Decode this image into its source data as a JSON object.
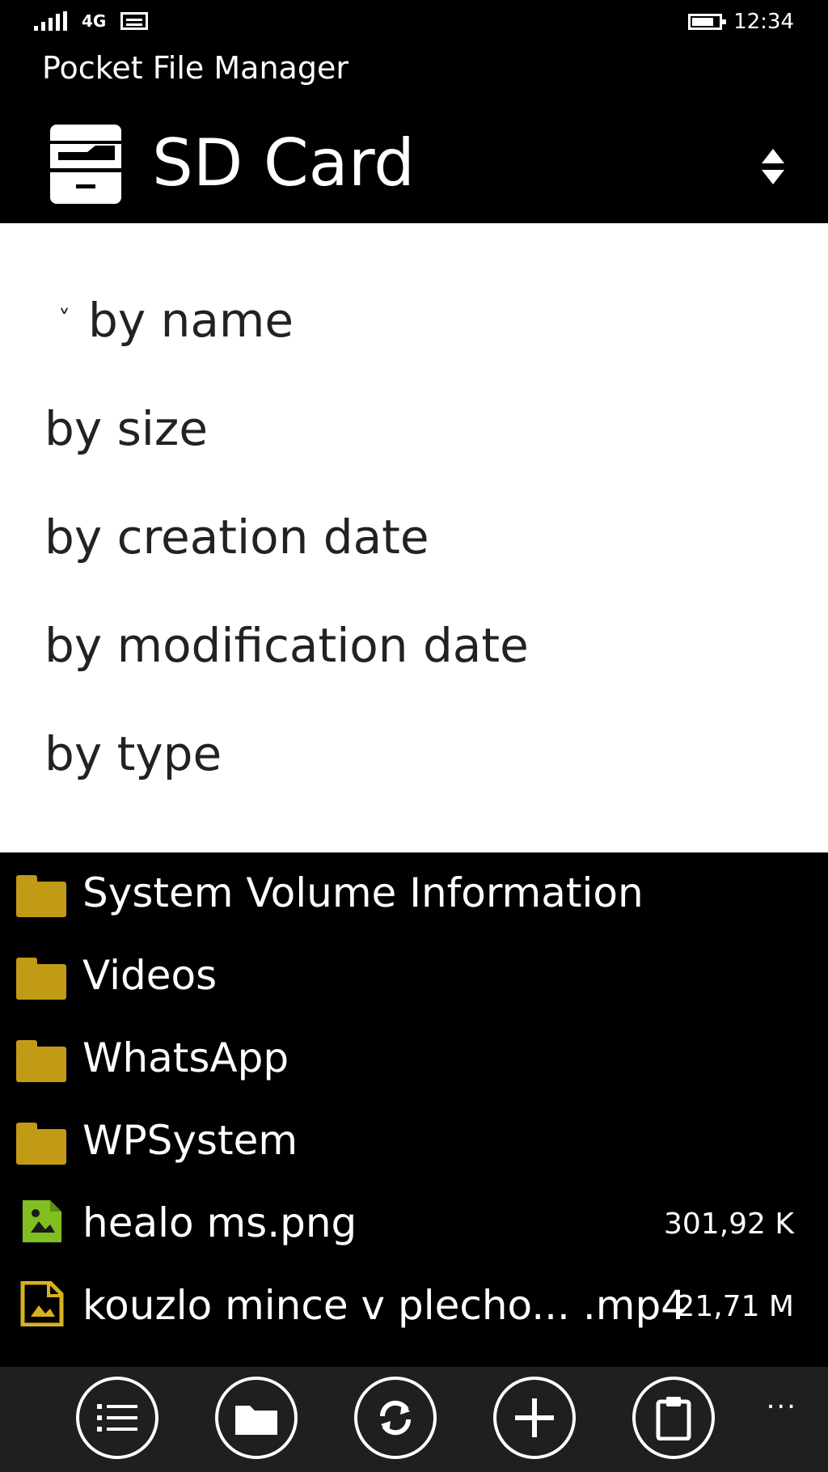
{
  "status": {
    "network": "4G",
    "time": "12:34"
  },
  "app": {
    "title": "Pocket File Manager"
  },
  "header": {
    "location": "SD Card"
  },
  "sort": {
    "selected_marker": "˅",
    "options": [
      "by name",
      "by size",
      "by creation date",
      "by modification date",
      "by type"
    ]
  },
  "files": [
    {
      "name": "System Volume Information",
      "size": "",
      "type": "folder"
    },
    {
      "name": "Videos",
      "size": "",
      "type": "folder"
    },
    {
      "name": "WhatsApp",
      "size": "",
      "type": "folder"
    },
    {
      "name": "WPSystem",
      "size": "",
      "type": "folder"
    },
    {
      "name": "healo ms.png",
      "size": "301,92 K",
      "type": "image"
    },
    {
      "name": "kouzlo mince v plecho... .mp4",
      "size": "21,71 M",
      "type": "video"
    }
  ],
  "appbar": {
    "more": "..."
  },
  "colors": {
    "folder": "#c19a16",
    "image_file": "#7fbf20",
    "video_file": "#d8b11f",
    "background": "#000000",
    "panel": "#ffffff"
  }
}
